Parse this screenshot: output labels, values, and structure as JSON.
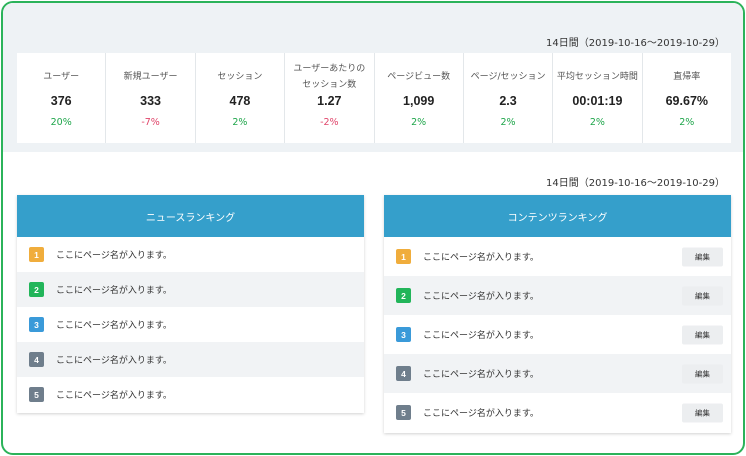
{
  "summary": {
    "period": "14日間（2019-10-16～2019-10-29）",
    "stats": [
      {
        "label": "ユーザー",
        "value": "376",
        "change": "20%",
        "direction": "up"
      },
      {
        "label": "新規ユーザー",
        "value": "333",
        "change": "-7%",
        "direction": "down"
      },
      {
        "label": "セッション",
        "value": "478",
        "change": "2%",
        "direction": "up"
      },
      {
        "label": "ユーザーあたりのセッション数",
        "label_line1": "ユーザーあたりの",
        "label_line2": "セッション数",
        "value": "1.27",
        "change": "-2%",
        "direction": "down"
      },
      {
        "label": "ページビュー数",
        "value": "1,099",
        "change": "2%",
        "direction": "up"
      },
      {
        "label": "ページ/セッション",
        "value": "2.3",
        "change": "2%",
        "direction": "up"
      },
      {
        "label": "平均セッション時間",
        "value": "00:01:19",
        "change": "2%",
        "direction": "up"
      },
      {
        "label": "直帰率",
        "value": "69.67%",
        "change": "2%",
        "direction": "up"
      }
    ]
  },
  "rankings_period": "14日間（2019-10-16～2019-10-29）",
  "news_ranking": {
    "title": "ニュースランキング",
    "items": [
      {
        "rank": "1",
        "label": "ここにページ名が入ります。",
        "badge_color": "#f0ad3c"
      },
      {
        "rank": "2",
        "label": "ここにページ名が入ります。",
        "badge_color": "#22b55a"
      },
      {
        "rank": "3",
        "label": "ここにページ名が入ります。",
        "badge_color": "#3a9ad9"
      },
      {
        "rank": "4",
        "label": "ここにページ名が入ります。",
        "badge_color": "#6f7e8c"
      },
      {
        "rank": "5",
        "label": "ここにページ名が入ります。",
        "badge_color": "#6f7e8c"
      }
    ]
  },
  "content_ranking": {
    "title": "コンテンツランキング",
    "edit_label": "編集",
    "items": [
      {
        "rank": "1",
        "label": "ここにページ名が入ります。",
        "badge_color": "#f0ad3c"
      },
      {
        "rank": "2",
        "label": "ここにページ名が入ります。",
        "badge_color": "#22b55a"
      },
      {
        "rank": "3",
        "label": "ここにページ名が入ります。",
        "badge_color": "#3a9ad9"
      },
      {
        "rank": "4",
        "label": "ここにページ名が入ります。",
        "badge_color": "#6f7e8c"
      },
      {
        "rank": "5",
        "label": "ここにページ名が入ります。",
        "badge_color": "#6f7e8c"
      }
    ]
  },
  "colors": {
    "frame_border": "#2bb35a",
    "header_bg": "#359fcb",
    "positive": "#1fa64b",
    "negative": "#e0456a"
  }
}
